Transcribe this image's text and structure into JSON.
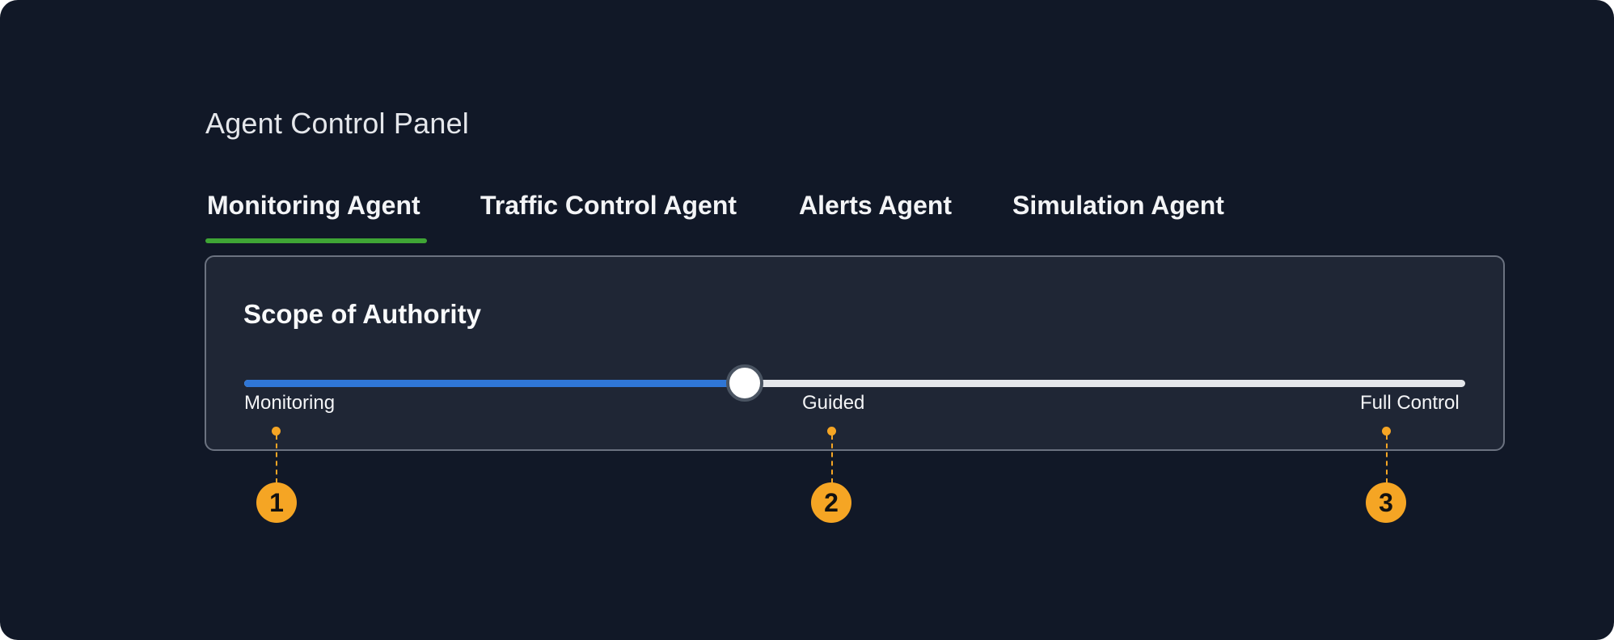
{
  "panel": {
    "title": "Agent Control Panel"
  },
  "tabs": [
    {
      "label": "Monitoring Agent",
      "selected": true
    },
    {
      "label": "Traffic Control Agent",
      "selected": false
    },
    {
      "label": "Alerts Agent",
      "selected": false
    },
    {
      "label": "Simulation Agent",
      "selected": false
    }
  ],
  "scope": {
    "title": "Scope of Authority",
    "slider": {
      "value_fraction": 0.41,
      "stops": [
        {
          "label": "Monitoring"
        },
        {
          "label": "Guided"
        },
        {
          "label": "Full Control"
        }
      ]
    }
  },
  "callouts": [
    {
      "number": "1"
    },
    {
      "number": "2"
    },
    {
      "number": "3"
    }
  ],
  "colors": {
    "background": "#111827",
    "card": "#1f2635",
    "tab_underline": "#3fa535",
    "slider_fill": "#2f76d6",
    "slider_track": "#e5e7eb",
    "callout": "#f5a524"
  }
}
